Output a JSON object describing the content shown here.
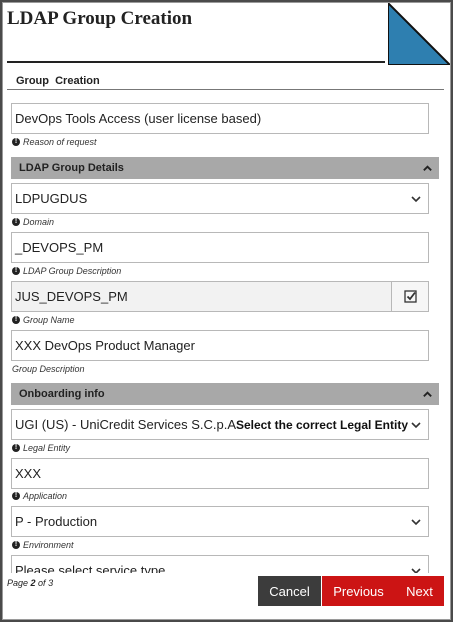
{
  "window": {
    "title": "LDAP Group Creation"
  },
  "tabs": {
    "current_label": "Group  Creation"
  },
  "form": {
    "reason": {
      "value": "DevOps Tools Access (user license based)",
      "help": "Reason of request"
    },
    "sections": {
      "ldap": {
        "title": "LDAP Group Details"
      },
      "onboarding": {
        "title": "Onboarding info"
      }
    },
    "domain": {
      "value": "LDPUGDUS",
      "help": "Domain"
    },
    "ldap_desc": {
      "value": "_DEVOPS_PM",
      "help": "LDAP Group Description"
    },
    "group_name": {
      "value": "JUS_DEVOPS_PM",
      "help": "Group Name"
    },
    "group_desc": {
      "value": "XXX DevOps Product Manager",
      "help": "Group Description"
    },
    "legal_entity": {
      "value": "UGI (US) - UniCredit Services S.C.p.A",
      "hint": "Select the correct Legal Entity",
      "help": "Legal Entity"
    },
    "application": {
      "value": "XXX",
      "help": "Application"
    },
    "environment": {
      "value": "P - Production",
      "help": "Environment"
    },
    "service_type": {
      "placeholder": "Please select service type"
    }
  },
  "footer": {
    "page_prefix": "Page ",
    "page_current": "2",
    "page_of": " of ",
    "page_total": "3",
    "cancel_label": "Cancel",
    "previous_label": "Previous",
    "next_label": "Next"
  },
  "colors": {
    "accent_red": "#cc1414",
    "corner_blue": "#2e7fb0",
    "section_gray": "#a8a8a8",
    "cancel_dark": "#3c3c3c"
  }
}
